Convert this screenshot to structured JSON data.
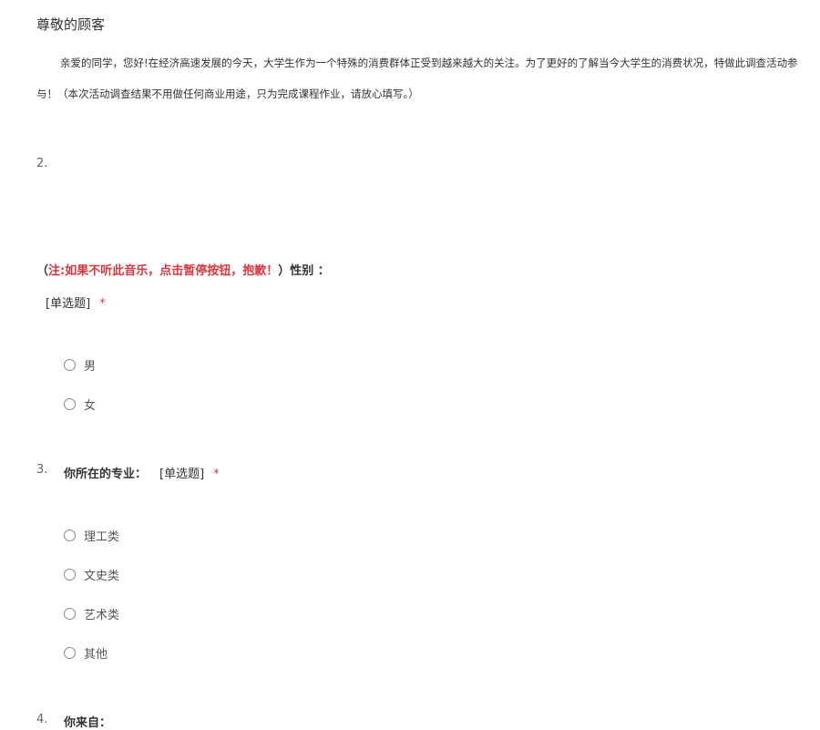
{
  "greeting": "尊敬的顾客",
  "intro": "亲爱的同学，您好!在经济高速发展的今天，大学生作为一个特殊的消费群体正受到越来越大的关注。为了更好的了解当今大学生的消费状况，特做此调查活动参与！（本次活动调查结果不用做任何商业用途，只为完成课程作业，请放心填写。）",
  "questions": {
    "q2": {
      "number": "2.",
      "open_paren": "（",
      "note": "注:如果不听此音乐，点击暂停按钮，抱歉！",
      "title": "）性别 ：",
      "type": "[单选题]",
      "required_mark": "*",
      "options": [
        "男",
        "女"
      ]
    },
    "q3": {
      "number": "3.",
      "title": "你所在的专业：",
      "type": "[单选题]",
      "required_mark": "*",
      "options": [
        "理工类",
        "文史类",
        "艺术类",
        "其他"
      ]
    },
    "q4": {
      "number": "4.",
      "title": "你来自："
    }
  }
}
